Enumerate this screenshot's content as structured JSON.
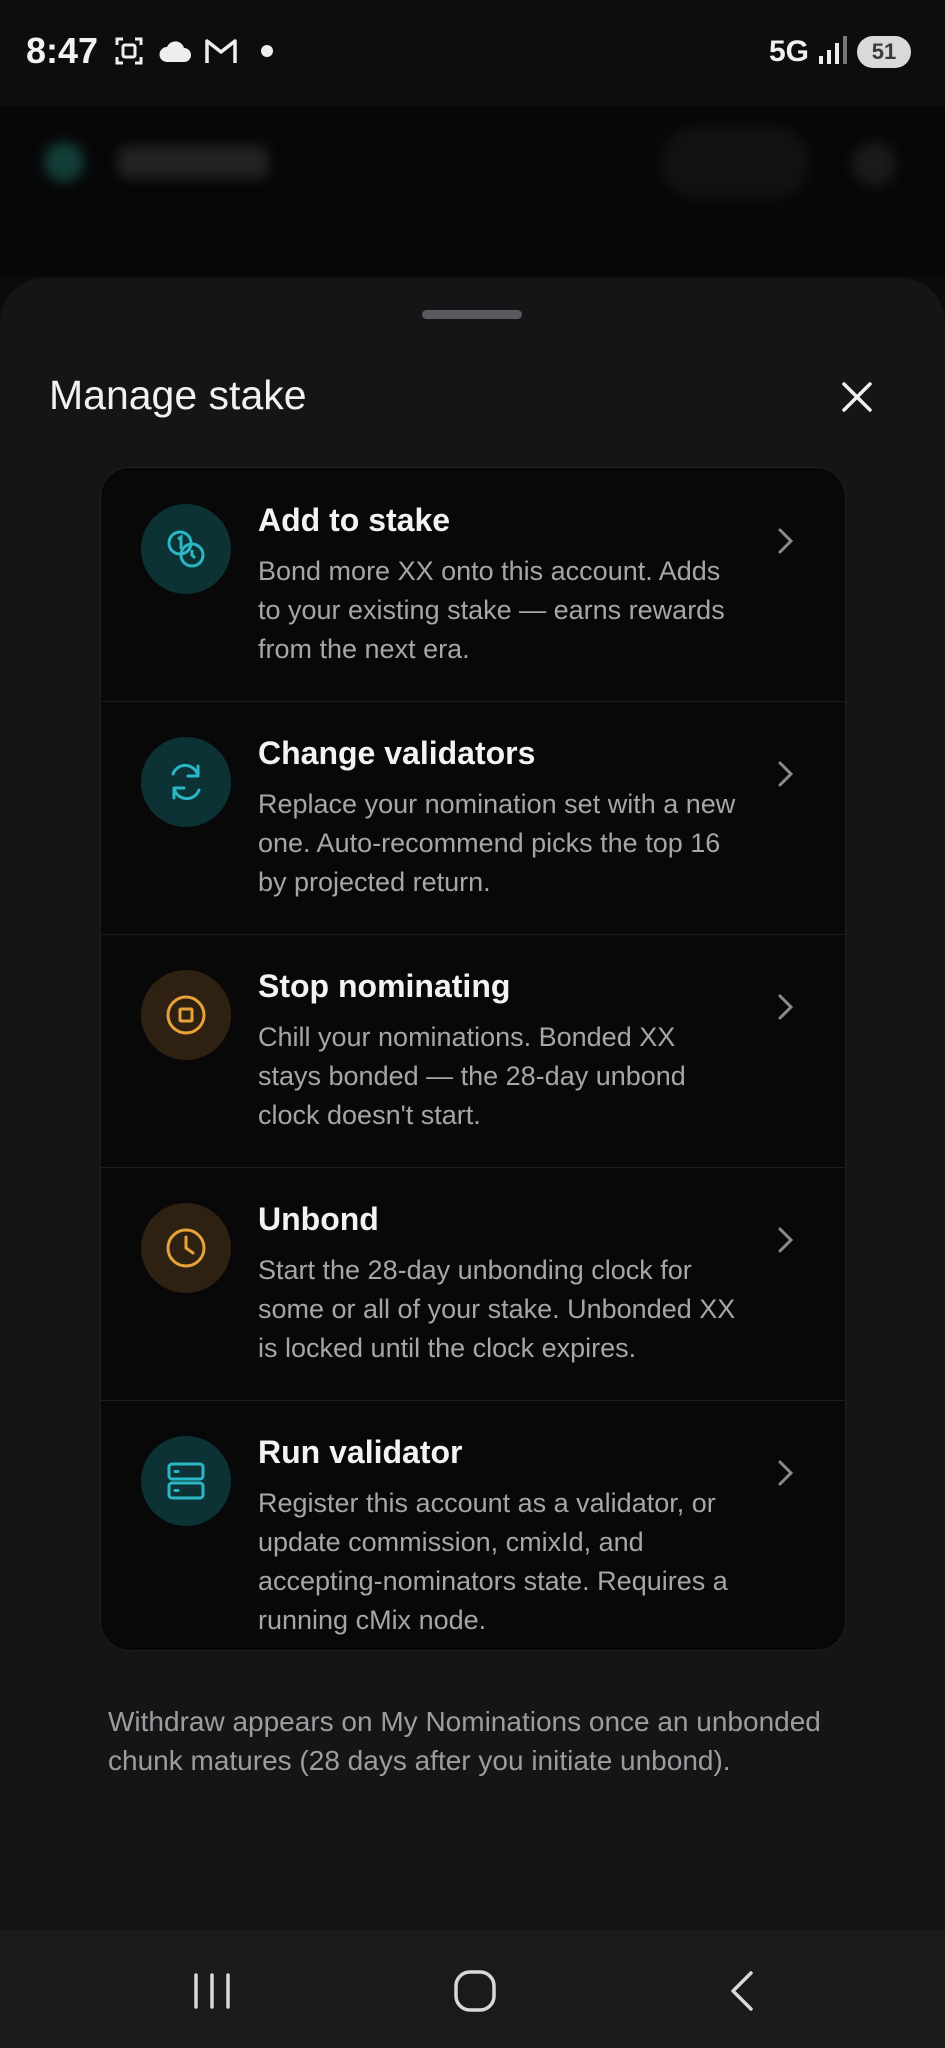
{
  "status_bar": {
    "time": "8:47",
    "icons": [
      "screenshot-icon",
      "cloud-icon",
      "gmail-icon",
      "dot-icon"
    ],
    "network": "5G",
    "battery": "51"
  },
  "sheet": {
    "title": "Manage stake",
    "close_label": "close"
  },
  "actions": [
    {
      "title": "Add to stake",
      "description": "Bond more XX onto this account. Adds to your existing stake — earns rewards from the next era.",
      "icon": "coins-icon",
      "accent": "#2bb6c4"
    },
    {
      "title": "Change validators",
      "description": "Replace your nomination set with a new one. Auto-recommend picks the top 16 by projected return.",
      "icon": "refresh-icon",
      "accent": "#2bb6c4"
    },
    {
      "title": "Stop nominating",
      "description": "Chill your nominations. Bonded XX stays bonded — the 28-day unbond clock doesn't start.",
      "icon": "stop-icon",
      "accent": "#e8a23a"
    },
    {
      "title": "Unbond",
      "description": "Start the 28-day unbonding clock for some or all of your stake. Unbonded XX is locked until the clock expires.",
      "icon": "clock-icon",
      "accent": "#e8a23a"
    },
    {
      "title": "Run validator",
      "description": "Register this account as a validator, or update commission, cmixId, and accepting-nominators state. Requires a running cMix node.",
      "icon": "server-icon",
      "accent": "#2bb6c4"
    }
  ],
  "footnote": "Withdraw appears on My Nominations once an unbonded chunk matures (28 days after you initiate unbond).",
  "colors": {
    "teal_accent": "#2bb6c4",
    "amber_accent": "#e8a23a",
    "sheet_bg": "#151517",
    "card_bg": "#080809"
  }
}
